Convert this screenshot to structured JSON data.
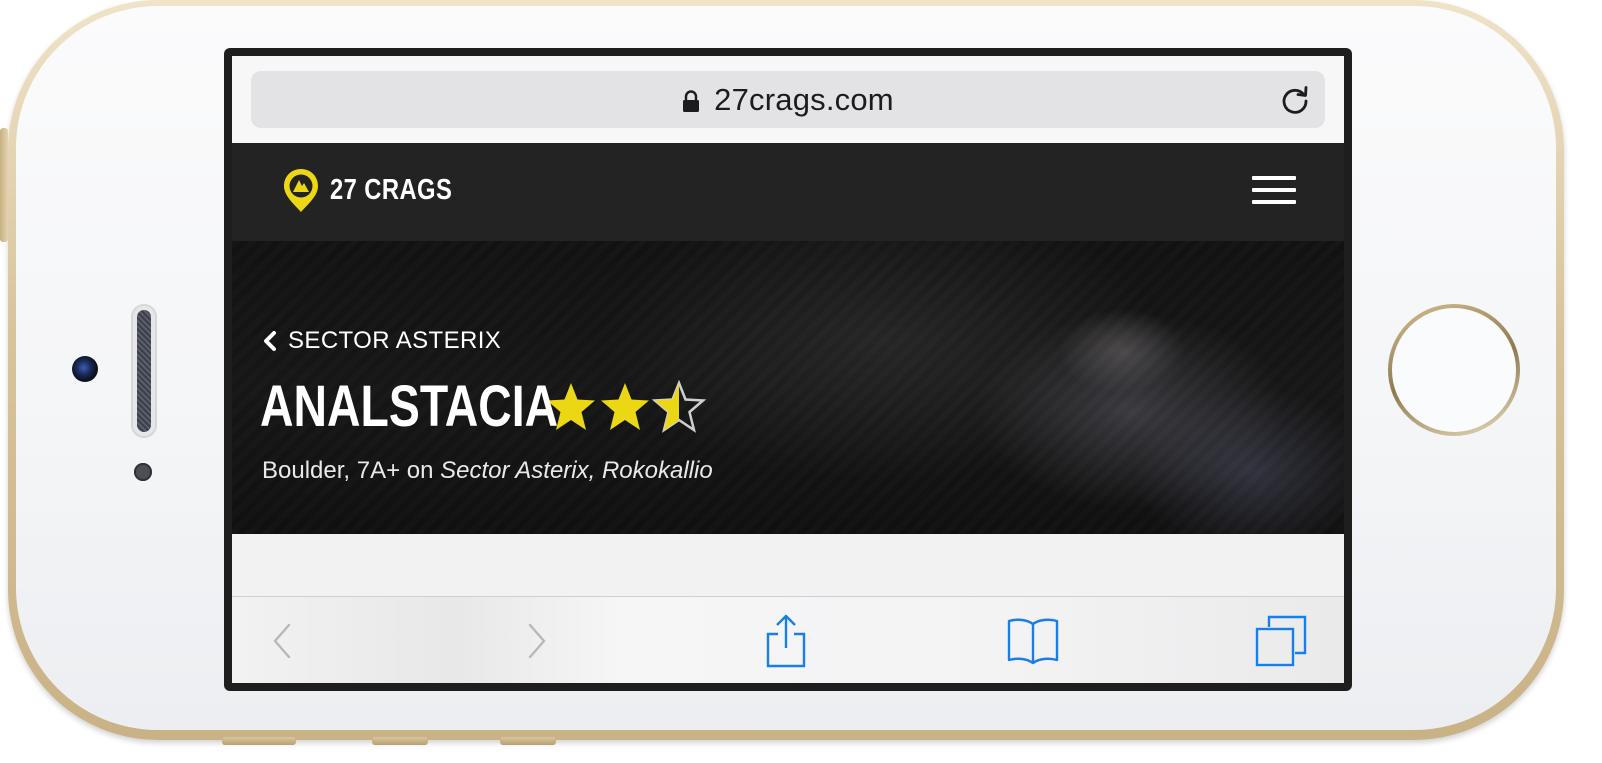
{
  "browser": {
    "url": "27crags.com"
  },
  "site": {
    "logo_text": "27 CRAGS",
    "brand_color": "#ecd714",
    "header_bg": "#232323"
  },
  "hero": {
    "breadcrumb": "SECTOR ASTERIX",
    "title": "ANALSTACIA",
    "rating": {
      "value": 2.5,
      "max": 3
    },
    "subtitle_prefix": "Boulder, 7A+ on ",
    "subtitle_location": "Sector Asterix, Rokokallio"
  },
  "toolbar": {
    "back": "back-icon",
    "forward": "forward-icon",
    "share": "share-icon",
    "bookmarks": "bookmarks-icon",
    "tabs": "tabs-icon",
    "accent_color": "#1a7ee6",
    "disabled_color": "#b8b8bc"
  },
  "device": {
    "frame_color": "#d8c49b"
  }
}
